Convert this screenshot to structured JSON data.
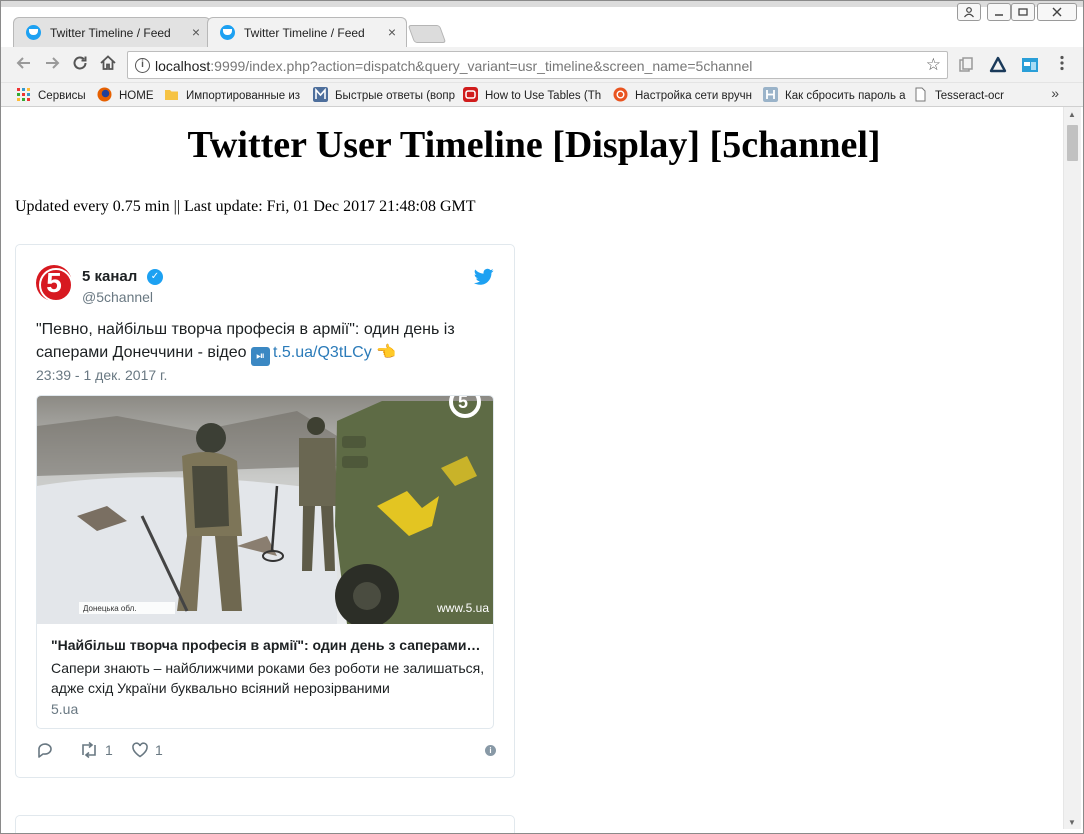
{
  "browser": {
    "tabs": [
      {
        "label": "Twitter Timeline / Feed",
        "close": "×"
      },
      {
        "label": "Twitter Timeline / Feed",
        "close": "×"
      }
    ],
    "address": {
      "host": "localhost",
      "path": ":9999/index.php?action=dispatch&query_variant=usr_timeline&screen_name=5channel"
    },
    "bookmarks": [
      {
        "label": "Сервисы",
        "icon": "apps-grid-icon"
      },
      {
        "label": "HOME",
        "icon": "firefox-icon"
      },
      {
        "label": "Импортированные из",
        "icon": "folder-icon"
      },
      {
        "label": "Быстрые ответы (вопр",
        "icon": "m-icon"
      },
      {
        "label": "How to Use Tables (Th",
        "icon": "red-tile-icon"
      },
      {
        "label": "Настройка сети вручн",
        "icon": "ubuntu-icon"
      },
      {
        "label": "Как сбросить пароль а",
        "icon": "h-icon"
      },
      {
        "label": "Tesseract-ocr",
        "icon": "page-icon"
      }
    ],
    "bookmarks_more": "»"
  },
  "page": {
    "title": "Twitter User Timeline [Display] [5channel]",
    "update_line": "Updated every 0.75 min || Last update: Fri, 01 Dec 2017 21:48:08 GMT"
  },
  "tweet": {
    "avatar_text": "5",
    "display_name": "5 канал",
    "handle": "@5channel",
    "text_main": "\"Певно, найбільш творча професія в армії\": один день із саперами Донеччини - відео ",
    "text_link": "t.5.ua/Q3tLCy",
    "text_emoji": " 👈",
    "timestamp": "23:39 - 1 дек. 2017 г.",
    "card": {
      "image_caption": "Донецька обл.",
      "image_watermark": "www.5.ua",
      "image_logo": "5",
      "title": "\"Найбільш творча професія в армії\": один день з саперами Донеччини",
      "description": "Сапери знають – найближчими роками без роботи не залишаться, адже схід України буквально всіяний нерозірваними",
      "domain": "5.ua"
    },
    "retweets": "1",
    "likes": "1"
  },
  "colors": {
    "twitter_blue": "#1da1f2",
    "channel_red": "#d71920",
    "link": "#2b7bb9",
    "muted": "#697882"
  }
}
